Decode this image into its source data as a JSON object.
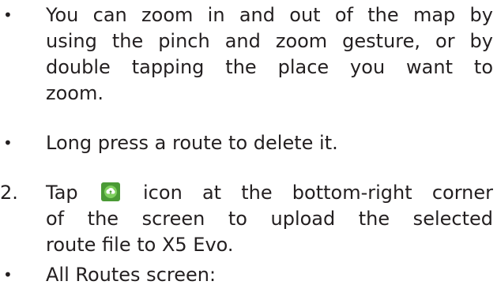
{
  "items": [
    {
      "marker": "•",
      "lines": [
        "You can zoom in and out of the map by",
        "using the pinch and zoom gesture, or by",
        "double tapping the place you want to",
        "zoom."
      ]
    },
    {
      "marker": "•",
      "lines": [
        "Long press a route to delete it."
      ]
    },
    {
      "marker": "2.",
      "line1_before_icon": "Tap",
      "line1_after_icon": "icon at the bottom-right corner",
      "icon": "upload-cloud-icon",
      "lines": [
        "of the screen to upload the selected",
        "route file to X5 Evo."
      ]
    },
    {
      "marker": "•",
      "lines": [
        "All Routes screen:"
      ]
    }
  ],
  "colors": {
    "text": "#231f20",
    "icon_background": "#4a9a35",
    "icon_foreground": "#ffffff"
  }
}
